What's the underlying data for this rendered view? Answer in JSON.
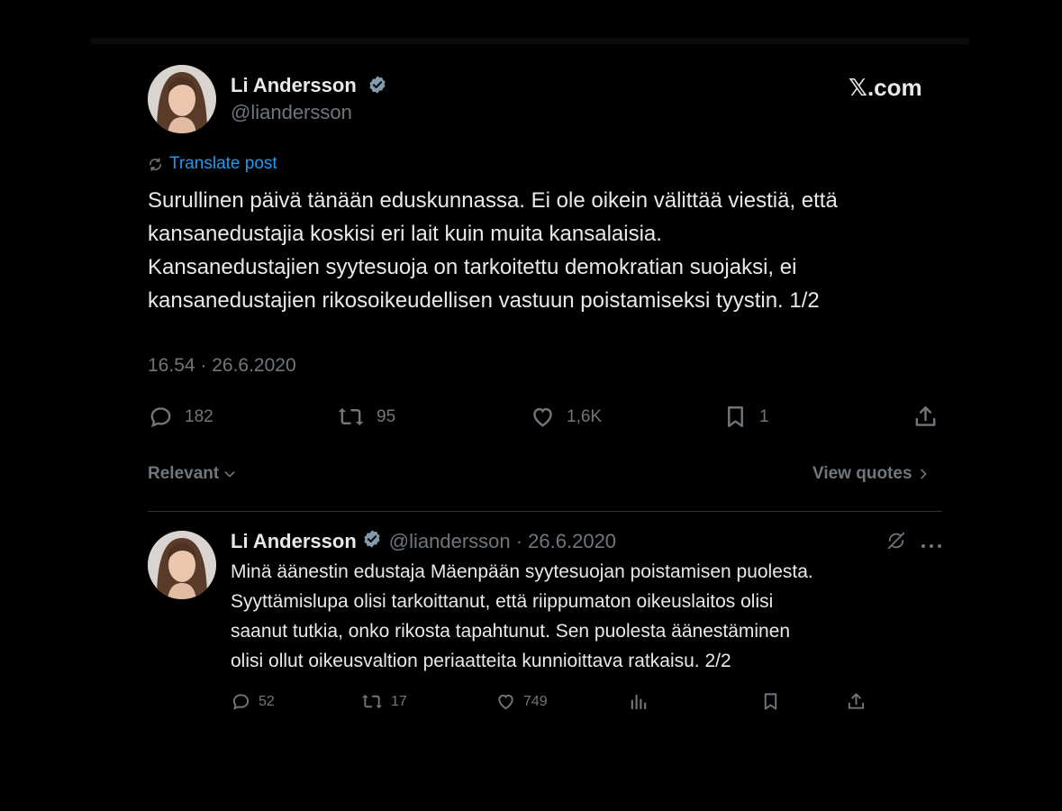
{
  "site": {
    "label": "𝕏.com"
  },
  "author": {
    "name": "Li Andersson",
    "handle": "@liandersson"
  },
  "main_post": {
    "translate_label": "Translate post",
    "lines": [
      "Surullinen päivä tänään eduskunnassa. Ei ole oikein välittää viestiä, että",
      "kansanedustajia koskisi eri lait kuin muita kansalaisia.",
      "Kansanedustajien syytesuoja on tarkoitettu demokratian suojaksi, ei",
      "kansanedustajien rikosoikeudellisen vastuun poistamiseksi tyystin. 1/2"
    ],
    "timestamp": "16.54 · 26.6.2020",
    "stats": {
      "replies": "182",
      "reposts": "95",
      "likes": "1,6K",
      "bookmarks": "1"
    }
  },
  "replies_bar": {
    "sort_label": "Relevant",
    "quotes_label": "View quotes"
  },
  "reply_post": {
    "name": "Li Andersson",
    "handle_date": "@liandersson · 26.6.2020",
    "lines": [
      "Minä äänestin edustaja Mäenpään syytesuojan poistamisen puolesta.",
      "Syyttämislupa olisi tarkoittanut, että riippumaton oikeuslaitos olisi",
      "saanut tutkia, onko rikosta tapahtunut. Sen puolesta äänestäminen",
      "olisi ollut oikeusvaltion periaatteita kunnioittava ratkaisu. 2/2"
    ],
    "stats": {
      "replies": "52",
      "reposts": "17",
      "likes": "749"
    }
  },
  "colors": {
    "accent": "#1d9bf0",
    "muted": "#71767b",
    "text": "#e7e9ea",
    "background": "#000000"
  }
}
